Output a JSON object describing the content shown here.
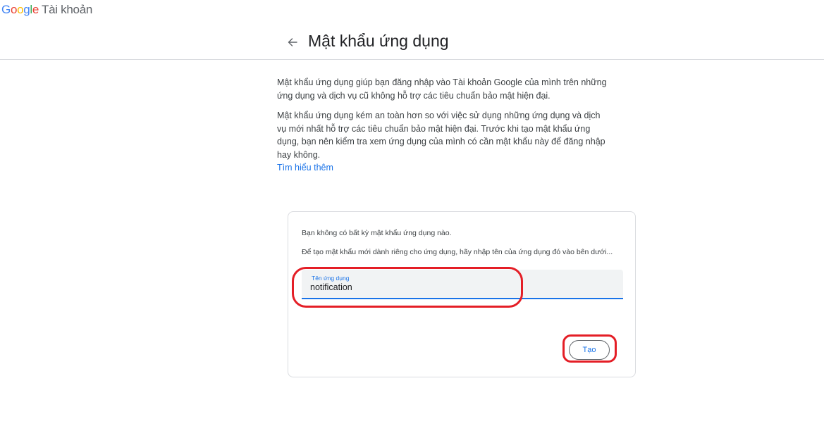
{
  "brand": {
    "logo_letters": [
      "G",
      "o",
      "o",
      "g",
      "l",
      "e"
    ],
    "product_name": "Tài khoản"
  },
  "header": {
    "back_icon": "arrow-left-icon",
    "title": "Mật khẩu ứng dụng"
  },
  "intro": {
    "paragraph1": "Mật khẩu ứng dụng giúp bạn đăng nhập vào Tài khoản Google của mình trên những ứng dụng và dịch vụ cũ không hỗ trợ các tiêu chuẩn bảo mật hiện đại.",
    "paragraph2": "Mật khẩu ứng dụng kém an toàn hơn so với việc sử dụng những ứng dụng và dịch vụ mới nhất hỗ trợ các tiêu chuẩn bảo mật hiện đại. Trước khi tạo mật khẩu ứng dụng, bạn nên kiểm tra xem ứng dụng của mình có cần mật khẩu này để đăng nhập hay không.",
    "learn_more": "Tìm hiểu thêm"
  },
  "card": {
    "empty_message": "Bạn không có bất kỳ mật khẩu ứng dụng nào.",
    "instruction": "Để tạo mật khẩu mới dành riêng cho ứng dụng, hãy nhập tên của ứng dụng đó vào bên dưới...",
    "field": {
      "label": "Tên ứng dụng",
      "value": "notification"
    },
    "create_button": "Tạo"
  },
  "colors": {
    "accent": "#1a73e8",
    "annotation": "#e41e26",
    "border": "#dadce0",
    "field_bg": "#f1f3f4"
  }
}
